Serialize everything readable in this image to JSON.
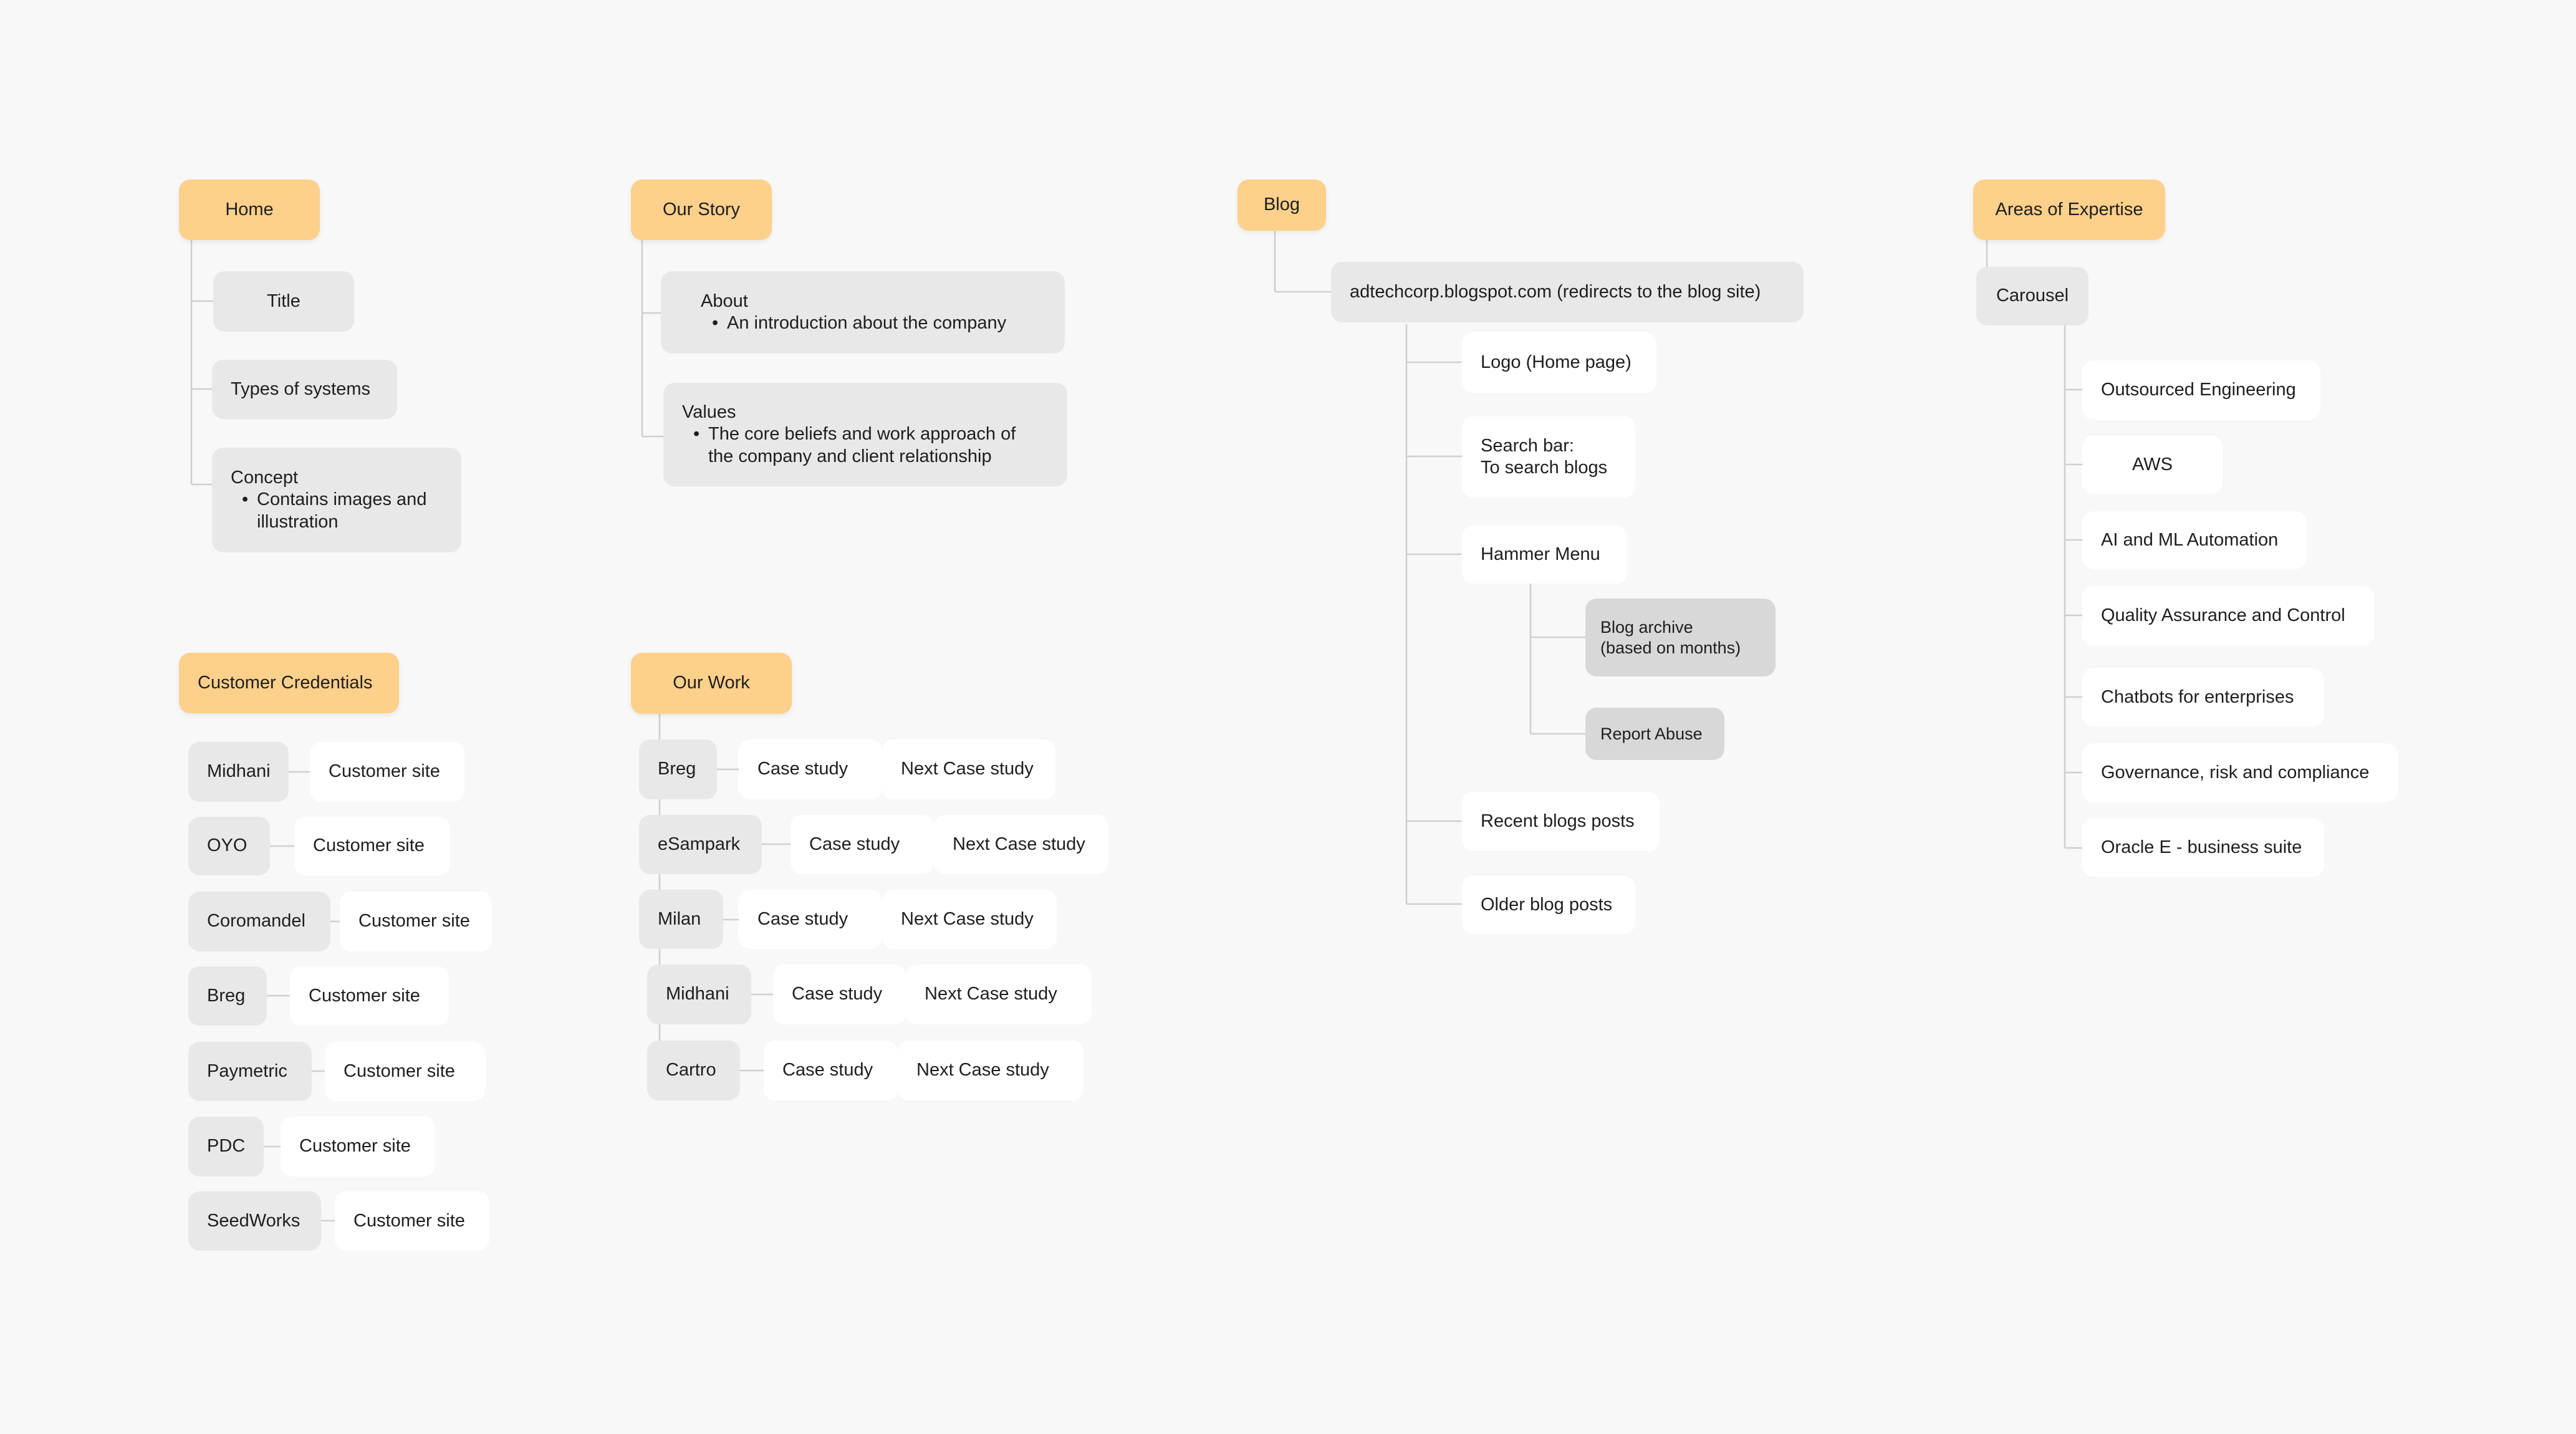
{
  "home": {
    "title": "Home",
    "items": {
      "title": "Title",
      "types": "Types of systems",
      "concept": {
        "label": "Concept",
        "lines": [
          "Contains images and",
          "illustration"
        ]
      }
    }
  },
  "our_story": {
    "title": "Our Story",
    "about": {
      "label": "About",
      "lines": [
        "An introduction about the company"
      ]
    },
    "values": {
      "label": "Values",
      "lines": [
        "The core beliefs and work approach of",
        "the company and client relationship"
      ]
    }
  },
  "blog": {
    "title": "Blog",
    "site": "adtechcorp.blogspot.com (redirects to the blog site)",
    "logo": "Logo (Home page)",
    "search": {
      "label": "Search bar:",
      "detail": "To search blogs"
    },
    "hammer_menu": "Hammer Menu",
    "archive": {
      "label": "Blog archive",
      "detail": "(based on months)"
    },
    "report": "Report Abuse",
    "recent": "Recent blogs posts",
    "older": "Older blog posts"
  },
  "expertise": {
    "title": "Areas of Expertise",
    "carousel": "Carousel",
    "items": [
      "Outsourced Engineering",
      "AWS",
      "AI and ML Automation",
      "Quality Assurance and Control",
      "Chatbots for enterprises",
      "Governance, risk and compliance",
      "Oracle E - business suite"
    ]
  },
  "customers": {
    "title": "Customer Credentials",
    "rows": [
      {
        "name": "Midhani",
        "site": "Customer site"
      },
      {
        "name": "OYO",
        "site": "Customer site"
      },
      {
        "name": "Coromandel",
        "site": "Customer site"
      },
      {
        "name": "Breg",
        "site": "Customer site"
      },
      {
        "name": "Paymetric",
        "site": "Customer site"
      },
      {
        "name": "PDC",
        "site": "Customer site"
      },
      {
        "name": "SeedWorks",
        "site": "Customer site"
      }
    ]
  },
  "our_work": {
    "title": "Our Work",
    "rows": [
      {
        "name": "Breg",
        "case": "Case study",
        "next": "Next Case study"
      },
      {
        "name": "eSampark",
        "case": "Case study",
        "next": "Next Case study"
      },
      {
        "name": "Milan",
        "case": "Case study",
        "next": "Next Case study"
      },
      {
        "name": "Midhani",
        "case": "Case study",
        "next": "Next Case study"
      },
      {
        "name": "Cartro",
        "case": "Case study",
        "next": "Next Case study"
      }
    ]
  }
}
